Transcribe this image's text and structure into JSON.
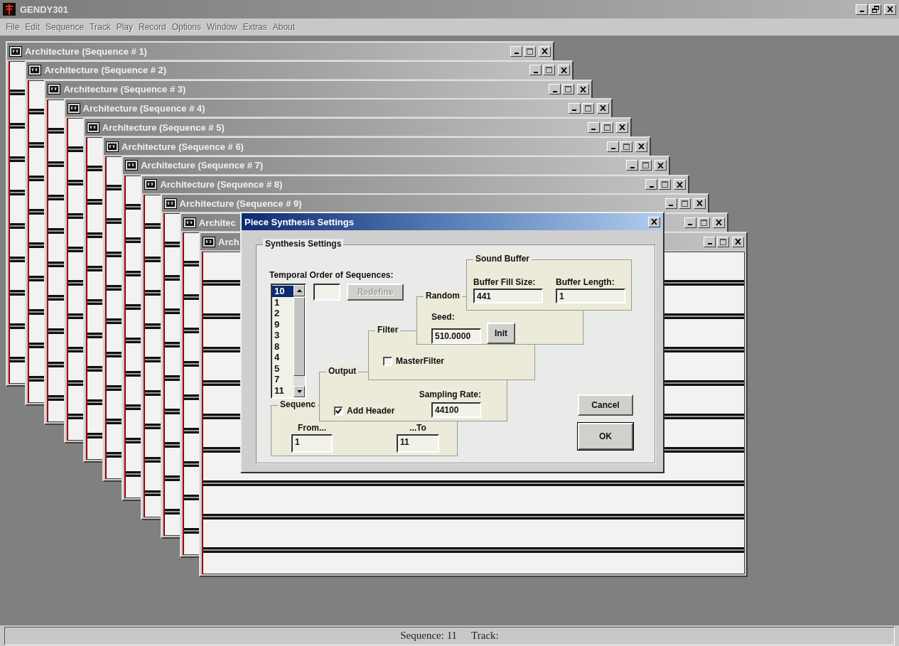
{
  "app": {
    "title": "GENDY301"
  },
  "menu": [
    "File",
    "Edit",
    "Sequence",
    "Track",
    "Play",
    "Record",
    "Options",
    "Window",
    "Extras",
    "About"
  ],
  "windows": [
    {
      "title": "Architecture (Sequence # 1)"
    },
    {
      "title": "Architecture (Sequence # 2)"
    },
    {
      "title": "Architecture (Sequence # 3)"
    },
    {
      "title": "Architecture (Sequence # 4)"
    },
    {
      "title": "Architecture (Sequence # 5)"
    },
    {
      "title": "Architecture (Sequence # 6)"
    },
    {
      "title": "Architecture (Sequence # 7)"
    },
    {
      "title": "Architecture (Sequence # 8)"
    },
    {
      "title": "Architecture (Sequence # 9)"
    },
    {
      "title": "Architec"
    },
    {
      "title": "Arch"
    }
  ],
  "dialog": {
    "title": "Piece Synthesis Settings",
    "group_title": "Synthesis Settings",
    "order_label": "Temporal Order of Sequences:",
    "order_list": [
      {
        "label": "10",
        "selected": true
      },
      {
        "label": "1",
        "selected": false
      },
      {
        "label": "2",
        "selected": false
      },
      {
        "label": "9",
        "selected": false
      },
      {
        "label": "3",
        "selected": false
      },
      {
        "label": "8",
        "selected": false
      },
      {
        "label": "4",
        "selected": false
      },
      {
        "label": "5",
        "selected": false
      },
      {
        "label": "7",
        "selected": false
      },
      {
        "label": "11",
        "selected": false
      }
    ],
    "redefine": {
      "label": "Redefine",
      "disabled": true
    },
    "sequence_range": {
      "title": "Sequenc",
      "from_label": "From...",
      "from": "1",
      "to_label": "...To",
      "to": "11"
    },
    "output": {
      "title": "Output",
      "sampling_rate_label": "Sampling Rate:",
      "sampling_rate": "44100",
      "add_header": {
        "label": "Add Header",
        "checked": true
      }
    },
    "filter": {
      "title": "Filter",
      "master_filter": {
        "label": "MasterFilter",
        "checked": false
      }
    },
    "random": {
      "title": "Random",
      "seed_label": "Seed:",
      "seed": "510.0000",
      "init_button": "Init"
    },
    "sound_buffer": {
      "title": "Sound Buffer",
      "fill_size_label": "Buffer Fill Size:",
      "fill_size": "441",
      "length_label": "Buffer Length:",
      "length": "1"
    },
    "buttons": [
      {
        "label": "Cancel",
        "default": false
      },
      {
        "label": "OK",
        "default": true
      }
    ]
  },
  "status_bar": {
    "sequence": "Sequence: 11",
    "track": "Track:"
  }
}
